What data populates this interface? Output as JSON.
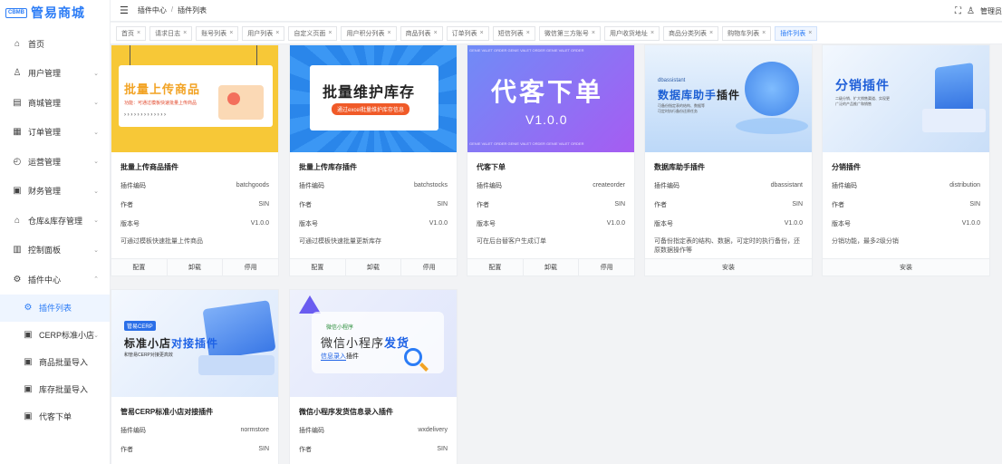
{
  "app": {
    "logo_mark": "CBMB",
    "title": "管易商城"
  },
  "sidebar": {
    "items": [
      {
        "label": "首页",
        "icon": "home-icon",
        "glyph": "⌂",
        "chevron": ""
      },
      {
        "label": "用户管理",
        "icon": "user-icon",
        "glyph": "♙",
        "chevron": "⌄"
      },
      {
        "label": "商城管理",
        "icon": "shop-icon",
        "glyph": "▤",
        "chevron": "⌄"
      },
      {
        "label": "订单管理",
        "icon": "order-icon",
        "glyph": "▦",
        "chevron": "⌄"
      },
      {
        "label": "运营管理",
        "icon": "operation-icon",
        "glyph": "◴",
        "chevron": "⌄"
      },
      {
        "label": "财务管理",
        "icon": "finance-icon",
        "glyph": "▣",
        "chevron": "⌄"
      },
      {
        "label": "仓库&库存管理",
        "icon": "warehouse-icon",
        "glyph": "⌂",
        "chevron": "⌄"
      },
      {
        "label": "控制面板",
        "icon": "dashboard-icon",
        "glyph": "▥",
        "chevron": "⌄"
      },
      {
        "label": "插件中心",
        "icon": "plugin-icon",
        "glyph": "⚙",
        "chevron": "⌃"
      }
    ],
    "submenu": [
      {
        "label": "插件列表",
        "icon": "plugin-list-icon",
        "glyph": "⚙",
        "chevron": "",
        "active": true
      },
      {
        "label": "CERP标准小店",
        "icon": "store-icon",
        "glyph": "▣",
        "chevron": "⌄"
      },
      {
        "label": "商品批量导入",
        "icon": "import-goods-icon",
        "glyph": "▣",
        "chevron": ""
      },
      {
        "label": "库存批量导入",
        "icon": "import-stock-icon",
        "glyph": "▣",
        "chevron": ""
      },
      {
        "label": "代客下单",
        "icon": "proxy-order-icon",
        "glyph": "▣",
        "chevron": ""
      }
    ]
  },
  "header": {
    "breadcrumb": [
      "插件中心",
      "插件列表"
    ],
    "separator": "/",
    "user_label": "管理员"
  },
  "tabs": [
    {
      "label": "首页"
    },
    {
      "label": "请求日志"
    },
    {
      "label": "账号列表"
    },
    {
      "label": "用户列表"
    },
    {
      "label": "自定义页面"
    },
    {
      "label": "用户积分列表"
    },
    {
      "label": "商品列表"
    },
    {
      "label": "订单列表"
    },
    {
      "label": "短信列表"
    },
    {
      "label": "微信第三方账号"
    },
    {
      "label": "用户收货地址"
    },
    {
      "label": "商品分类列表"
    },
    {
      "label": "购物车列表"
    },
    {
      "label": "插件列表",
      "active": true
    }
  ],
  "field_labels": {
    "code": "插件编码",
    "author": "作者",
    "version": "版本号"
  },
  "plugins": [
    {
      "name": "批量上传商品插件",
      "code": "batchgoods",
      "author": "SIN",
      "version": "V1.0.0",
      "desc": "可通过模板快速批量上传商品",
      "actions": [
        "配置",
        "卸载",
        "停用"
      ],
      "banner": {
        "title": "批量上传商品",
        "sub": "功能：可通过模板快速批量上传商品",
        "arrows": "› › › › › › › › › › › › ›",
        "bg": "#f7c837"
      }
    },
    {
      "name": "批量上传库存插件",
      "code": "batchstocks",
      "author": "SIN",
      "version": "V1.0.0",
      "desc": "可通过模板快速批量更新库存",
      "actions": [
        "配置",
        "卸载",
        "停用"
      ],
      "banner": {
        "title": "批量维护库存",
        "sub": "通过excel批量维护库存信息",
        "bg": "#2d8ff0"
      }
    },
    {
      "name": "代客下单",
      "code": "createorder",
      "author": "SIN",
      "version": "V1.0.0",
      "desc": "可在后台替客户生成订单",
      "actions": [
        "配置",
        "卸载",
        "停用"
      ],
      "banner": {
        "title": "代客下单",
        "version": "V1.0.0",
        "strip": "GENIE VALET ORDER GENIE VALET ORDER GENIE VALET ORDER",
        "bg": "#8a5cf5"
      }
    },
    {
      "name": "数据库助手插件",
      "code": "dbassistant",
      "author": "SIN",
      "version": "V1.0.0",
      "desc": "可备份指定表的结构、数据，可定时的执行备份，还原数据操作等",
      "actions": [
        "安装"
      ],
      "banner": {
        "small": "dbassistant",
        "title": "数据库助手",
        "title_suffix": "插件",
        "sub1": "可备份指定表的结构、数据等",
        "sub2": "可定时执行备份还原任务",
        "bg": "#cfe4fb"
      }
    },
    {
      "name": "分销插件",
      "code": "distribution",
      "author": "SIN",
      "version": "V1.0.0",
      "desc": "分销功能，最多2级分销",
      "actions": [
        "安装"
      ],
      "banner": {
        "title": "分销插件",
        "sub1": "二级分销、扩大销售渠道、实现更",
        "sub2": "广泛的产品推广和销售",
        "bg": "#dbe9fb"
      }
    },
    {
      "name": "管易CERP标准小店对接插件",
      "code": "normstore",
      "author": "SIN",
      "version": "V1.0.0",
      "desc": "",
      "actions": [],
      "banner": {
        "badge": "管易CERP",
        "title_a": "标准小店",
        "title_b": "对接插件",
        "sub": "和管易CERP对接更高效",
        "bg": "#e6f0fc"
      }
    },
    {
      "name": "微信小程序发货信息录入插件",
      "code": "wxdelivery",
      "author": "SIN",
      "version": "V1.0.0",
      "desc": "",
      "actions": [],
      "banner": {
        "badge": "微信小程序",
        "title_a": "微信小程序",
        "title_b": "发货",
        "sub_a": "信息录入",
        "sub_b": "插件",
        "bg": "#ece9fb"
      }
    }
  ]
}
